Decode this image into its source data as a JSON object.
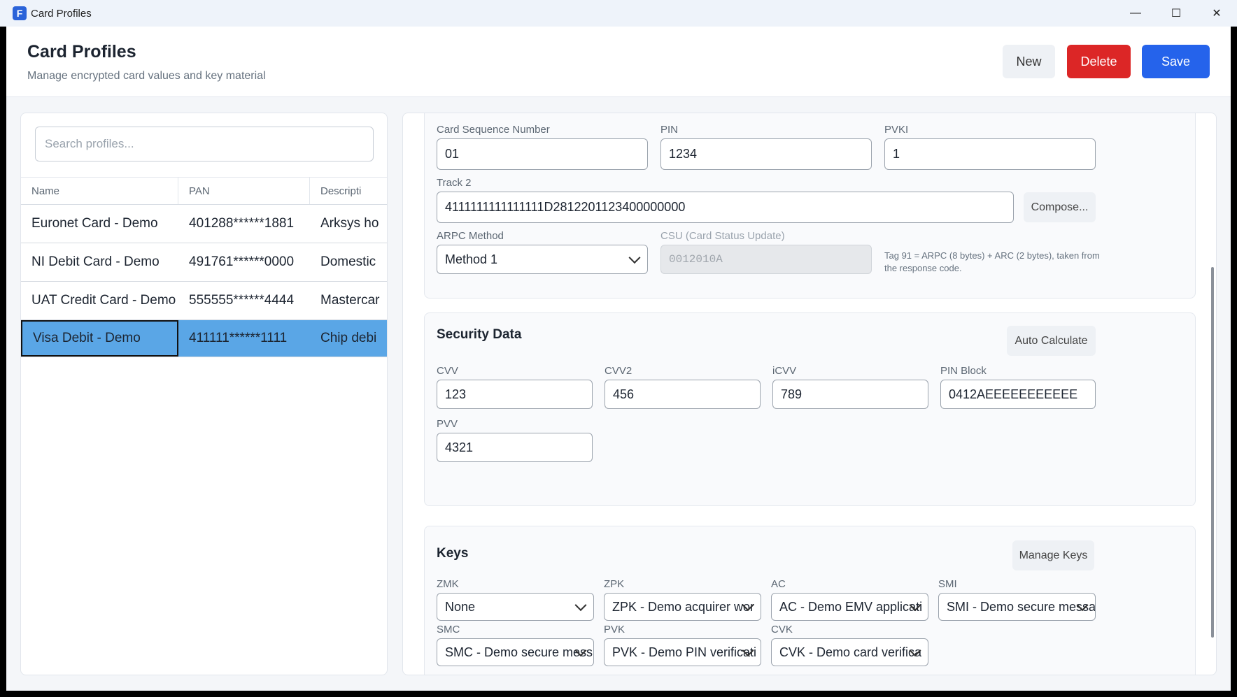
{
  "window": {
    "app_icon_letter": "F",
    "title": "Card Profiles",
    "minimize_glyph": "—",
    "maximize_glyph": "☐",
    "close_glyph": "✕"
  },
  "header": {
    "title": "Card Profiles",
    "subtitle": "Manage encrypted card values and key material",
    "new_label": "New",
    "delete_label": "Delete",
    "save_label": "Save"
  },
  "list": {
    "search_placeholder": "Search profiles...",
    "columns": [
      "Name",
      "PAN",
      "Descripti"
    ],
    "rows": [
      {
        "name": "Euronet Card - Demo",
        "pan": "401288******1881",
        "desc": "Arksys ho"
      },
      {
        "name": "NI Debit Card - Demo",
        "pan": "491761******0000",
        "desc": "Domestic"
      },
      {
        "name": "UAT Credit Card - Demo",
        "pan": "555555******4444",
        "desc": "Mastercar"
      },
      {
        "name": "Visa Debit - Demo",
        "pan": "411111******1111",
        "desc": "Chip debi"
      }
    ],
    "selected_index": 3
  },
  "card": {
    "csn_label": "Card Sequence Number",
    "csn_value": "01",
    "pin_label": "PIN",
    "pin_value": "1234",
    "pvki_label": "PVKI",
    "pvki_value": "1",
    "track2_label": "Track 2",
    "track2_value": "4111111111111111D2812201123400000000",
    "compose_label": "Compose...",
    "arpc_label": "ARPC Method",
    "arpc_value": "Method 1",
    "csu_label": "CSU (Card Status Update)",
    "csu_value": "0012010A",
    "tag_note": "Tag 91 = ARPC (8 bytes) + ARC (2 bytes), taken from the response code."
  },
  "security": {
    "title": "Security Data",
    "auto_label": "Auto Calculate",
    "cvv_label": "CVV",
    "cvv_value": "123",
    "cvv2_label": "CVV2",
    "cvv2_value": "456",
    "icvv_label": "iCVV",
    "icvv_value": "789",
    "pinblock_label": "PIN Block",
    "pinblock_value": "0412AEEEEEEEEEEE",
    "pvv_label": "PVV",
    "pvv_value": "4321"
  },
  "keys": {
    "title": "Keys",
    "manage_label": "Manage Keys",
    "zmk_label": "ZMK",
    "zmk_value": "None",
    "zpk_label": "ZPK",
    "zpk_value": "ZPK - Demo acquirer wor",
    "ac_label": "AC",
    "ac_value": "AC - Demo EMV applicati",
    "smi_label": "SMI",
    "smi_value": "SMI - Demo secure messa",
    "smc_label": "SMC",
    "smc_value": "SMC - Demo secure mess",
    "pvk_label": "PVK",
    "pvk_value": "PVK - Demo PIN verificati",
    "cvk_label": "CVK",
    "cvk_value": "CVK - Demo card verifica"
  }
}
